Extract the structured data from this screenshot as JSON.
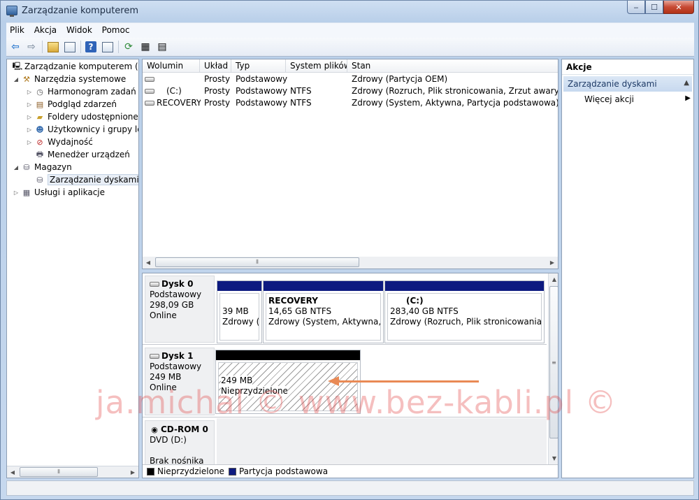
{
  "window": {
    "title": "Zarządzanie komputerem",
    "caption": {
      "minimize": "‒",
      "maximize": "☐",
      "close": "✕"
    }
  },
  "menu": [
    "Plik",
    "Akcja",
    "Widok",
    "Pomoc"
  ],
  "toolbar": {
    "icons": [
      "back-icon",
      "forward-icon",
      "up-folder-icon",
      "show-hide-tree-icon",
      "help-icon",
      "show-hide-action-pane-icon",
      "refresh-icon",
      "properties-icon",
      "export-icon"
    ]
  },
  "tree": {
    "items": [
      {
        "label": "Zarządzanie komputerem (loka",
        "icon": "computer-management-icon",
        "expander": "",
        "indent": 0
      },
      {
        "label": "Narzędzia systemowe",
        "icon": "system-tools-icon",
        "expander": "◢",
        "indent": 1
      },
      {
        "label": "Harmonogram zadań",
        "icon": "clock-icon",
        "expander": "▷",
        "indent": 2
      },
      {
        "label": "Podgląd zdarzeń",
        "icon": "event-viewer-icon",
        "expander": "▷",
        "indent": 2
      },
      {
        "label": "Foldery udostępnione",
        "icon": "shared-folder-icon",
        "expander": "▷",
        "indent": 2
      },
      {
        "label": "Użytkownicy i grupy lok",
        "icon": "users-icon",
        "expander": "▷",
        "indent": 2
      },
      {
        "label": "Wydajność",
        "icon": "performance-icon",
        "expander": "▷",
        "indent": 2
      },
      {
        "label": "Menedżer urządzeń",
        "icon": "device-manager-icon",
        "expander": "",
        "indent": 2
      },
      {
        "label": "Magazyn",
        "icon": "storage-icon",
        "expander": "◢",
        "indent": 1
      },
      {
        "label": "Zarządzanie dyskami",
        "icon": "disk-management-icon",
        "expander": "",
        "indent": 2,
        "selected": true
      },
      {
        "label": "Usługi i aplikacje",
        "icon": "services-icon",
        "expander": "▷",
        "indent": 1
      }
    ]
  },
  "volumes": {
    "headers": [
      "Wolumin",
      "Układ",
      "Typ",
      "System plików",
      "Stan"
    ],
    "rows": [
      [
        "",
        "Prosty",
        "Podstawowy",
        "",
        "Zdrowy (Partycja OEM)"
      ],
      [
        "(C:)",
        "Prosty",
        "Podstawowy",
        "NTFS",
        "Zdrowy (Rozruch, Plik stronicowania, Zrzut awaryjny, Partycja p"
      ],
      [
        "RECOVERY",
        "Prosty",
        "Podstawowy",
        "NTFS",
        "Zdrowy (System, Aktywna, Partycja podstawowa)"
      ]
    ]
  },
  "disks": [
    {
      "name": "Dysk 0",
      "type": "Podstawowy",
      "size": "298,09 GB",
      "status": "Online",
      "partitions": [
        {
          "name": "",
          "size": "39 MB",
          "status": "Zdrowy (P"
        },
        {
          "name": "RECOVERY",
          "size": "14,65 GB NTFS",
          "status": "Zdrowy (System, Aktywna, Pa"
        },
        {
          "name": "(C:)",
          "size": "283,40 GB NTFS",
          "status": "Zdrowy (Rozruch, Plik stronicowania, Zrz"
        }
      ]
    },
    {
      "name": "Dysk 1",
      "type": "Podstawowy",
      "size": "249 MB",
      "status": "Online",
      "partitions": [
        {
          "name": "",
          "size": "249 MB",
          "status": "Nieprzydzielone"
        }
      ]
    },
    {
      "name": "CD-ROM 0",
      "type": "DVD (D:)",
      "size": "",
      "status": "Brak nośnika"
    }
  ],
  "legend": [
    {
      "label": "Nieprzydzielone",
      "color": "#000000"
    },
    {
      "label": "Partycja podstawowa",
      "color": "#0d1a80"
    }
  ],
  "actions": {
    "header": "Akcje",
    "section": "Zarządzanie dyskami",
    "more": "Więcej akcji"
  },
  "watermark": "ja.michal © www.bez-kabli.pl ©"
}
